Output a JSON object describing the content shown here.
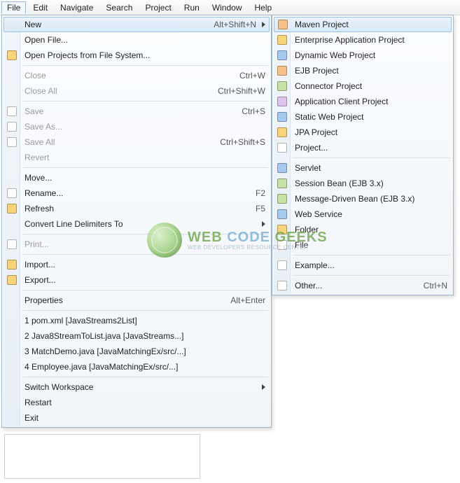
{
  "menubar": [
    "File",
    "Edit",
    "Navigate",
    "Search",
    "Project",
    "Run",
    "Window",
    "Help"
  ],
  "file_menu": {
    "new": {
      "label": "New",
      "accel": "Alt+Shift+N"
    },
    "open_file": "Open File...",
    "open_projects": "Open Projects from File System...",
    "close": {
      "label": "Close",
      "accel": "Ctrl+W"
    },
    "close_all": {
      "label": "Close All",
      "accel": "Ctrl+Shift+W"
    },
    "save": {
      "label": "Save",
      "accel": "Ctrl+S"
    },
    "save_as": "Save As...",
    "save_all": {
      "label": "Save All",
      "accel": "Ctrl+Shift+S"
    },
    "revert": "Revert",
    "move": "Move...",
    "rename": {
      "label": "Rename...",
      "accel": "F2"
    },
    "refresh": {
      "label": "Refresh",
      "accel": "F5"
    },
    "convert": "Convert Line Delimiters To",
    "print": "Print...",
    "import": "Import...",
    "export": "Export...",
    "properties": {
      "label": "Properties",
      "accel": "Alt+Enter"
    },
    "recent": [
      "1 pom.xml  [JavaStreams2List]",
      "2 Java8StreamToList.java  [JavaStreams...]",
      "3 MatchDemo.java  [JavaMatchingEx/src/...]",
      "4 Employee.java  [JavaMatchingEx/src/...]"
    ],
    "switch_ws": "Switch Workspace",
    "restart": "Restart",
    "exit": "Exit"
  },
  "new_submenu": {
    "maven": "Maven Project",
    "eap": "Enterprise Application Project",
    "dwp": "Dynamic Web Project",
    "ejb": "EJB Project",
    "conn": "Connector Project",
    "acp": "Application Client Project",
    "swp": "Static Web Project",
    "jpa": "JPA Project",
    "project": "Project...",
    "servlet": "Servlet",
    "session": "Session Bean (EJB 3.x)",
    "mdb": "Message-Driven Bean (EJB 3.x)",
    "ws": "Web Service",
    "folder": "Folder",
    "file": "File",
    "example": "Example...",
    "other": {
      "label": "Other...",
      "accel": "Ctrl+N"
    }
  },
  "watermark": {
    "line1a": "WEB ",
    "line1b": "CODE ",
    "line1c": "GEEKS",
    "line2": "WEB DEVELOPERS RESOURCE CENTER"
  }
}
